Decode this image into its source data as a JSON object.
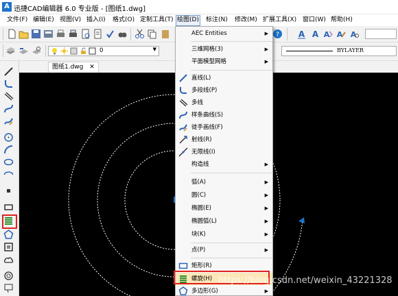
{
  "window": {
    "logo_text": "A",
    "title": "迅捷CAD编辑器 6.0 专业版 - [图纸1.dwg]"
  },
  "menubar": {
    "items": [
      {
        "label": "文件(F)"
      },
      {
        "label": "编辑(E)"
      },
      {
        "label": "视图(V)"
      },
      {
        "label": "插入(I)"
      },
      {
        "label": "格式(O)"
      },
      {
        "label": "定制工具(T)"
      },
      {
        "label": "绘图(D)"
      },
      {
        "label": "标注(N)"
      },
      {
        "label": "修改(M)"
      },
      {
        "label": "扩展工具(X)"
      },
      {
        "label": "窗口(W)"
      },
      {
        "label": "帮助(H)"
      }
    ]
  },
  "toolbar2": {
    "layer_value": "0",
    "linetype_value": "BYLAYER"
  },
  "document": {
    "tab_label": "图纸1.dwg",
    "tab_close": "✕"
  },
  "draw_menu": {
    "items": [
      {
        "label": "AEC Entities",
        "submenu": true
      },
      {
        "label": "三维网格(3)",
        "submenu": true
      },
      {
        "label": "平面模型网格",
        "submenu": true
      },
      {
        "label": "直线(L)",
        "icon": "line-icon"
      },
      {
        "label": "多段线(P)",
        "icon": "polyline-icon"
      },
      {
        "label": "多线",
        "icon": "multiline-icon"
      },
      {
        "label": "样条曲线(S)",
        "icon": "spline-icon"
      },
      {
        "label": "徒手画线(F)",
        "icon": "freehand-icon"
      },
      {
        "label": "射线(R)",
        "icon": "ray-icon"
      },
      {
        "label": "无限线(I)",
        "icon": "xline-icon"
      },
      {
        "label": "构造线",
        "submenu": true
      },
      {
        "label": "弧(A)",
        "submenu": true
      },
      {
        "label": "圆(C)",
        "submenu": true
      },
      {
        "label": "椭圆(E)",
        "submenu": true
      },
      {
        "label": "椭圆弧(L)",
        "submenu": true
      },
      {
        "label": "块(K)",
        "submenu": true
      },
      {
        "label": "点(P)",
        "submenu": true
      },
      {
        "label": "矩形(R)",
        "icon": "rectangle-icon"
      },
      {
        "label": "螺旋(H)",
        "icon": "helix-icon",
        "highlighted": true
      },
      {
        "label": "多边形(G)",
        "icon": "polygon-icon",
        "submenu": true
      }
    ],
    "submenu_arrow": "▶"
  },
  "watermark": "https://blog.csdn.net/weixin_43221328",
  "colors": {
    "accent": "#1e73c8",
    "highlight_border": "#e02020",
    "canvas": "#000000",
    "menu_highlight": "#fbe7b8"
  }
}
